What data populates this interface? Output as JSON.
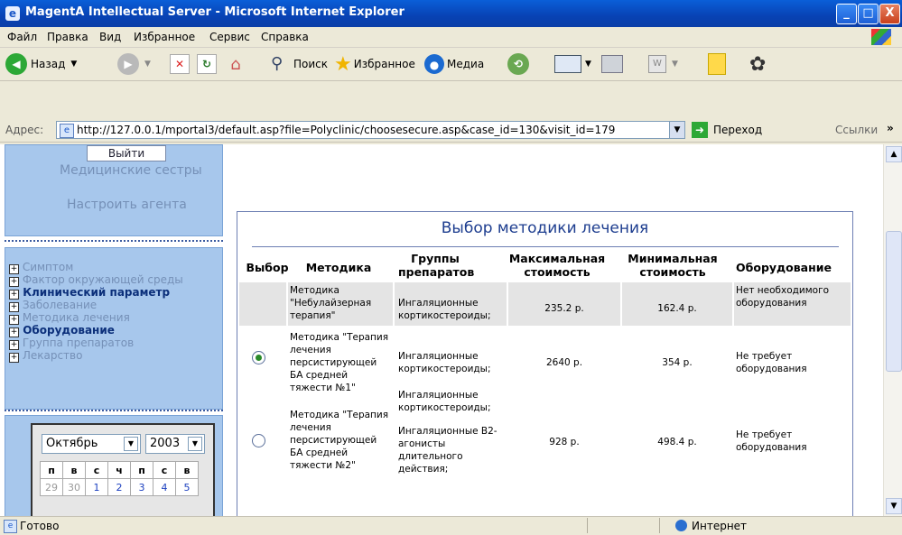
{
  "window": {
    "title": "MagentA Intellectual Server - Microsoft Internet Explorer",
    "min_label": "_",
    "max_label": "□",
    "close_label": "X"
  },
  "menu": {
    "items": [
      "Файл",
      "Правка",
      "Вид",
      "Избранное",
      "Сервис",
      "Справка"
    ]
  },
  "toolbar": {
    "back_label": "Назад",
    "search_label": "Поиск",
    "favorites_label": "Избранное",
    "media_label": "Медиа"
  },
  "address": {
    "label": "Адрес:",
    "url": "http://127.0.0.1/mportal3/default.asp?file=Polyclinic/choosesecure.asp&case_id=130&visit_id=179",
    "go_label": "Переход",
    "links_label": "Ссылки"
  },
  "sidebar": {
    "logout_label": "Выйти",
    "nurses_label": "Медицинские сестры",
    "configure_label": "Настроить агента",
    "tree": [
      {
        "label": "Симптом",
        "bold": false
      },
      {
        "label": "Фактор окружающей среды",
        "bold": false
      },
      {
        "label": "Клинический параметр",
        "bold": true
      },
      {
        "label": "Заболевание",
        "bold": false
      },
      {
        "label": "Методика лечения",
        "bold": false
      },
      {
        "label": "Оборудование",
        "bold": true
      },
      {
        "label": "Группа препаратов",
        "bold": false
      },
      {
        "label": "Лекарство",
        "bold": false
      }
    ],
    "calendar": {
      "month": "Октябрь",
      "year": "2003",
      "weekdays": [
        "п",
        "в",
        "с",
        "ч",
        "п",
        "с",
        "в"
      ],
      "days": [
        "29",
        "30",
        "1",
        "2",
        "3",
        "4",
        "5"
      ]
    }
  },
  "main": {
    "title": "Выбор методики лечения",
    "headers": {
      "select": "Выбор",
      "method": "Методика",
      "groups": "Группы препаратов",
      "max_cost": "Максимальная стоимость",
      "min_cost": "Минимальная стоимость",
      "equipment": "Оборудование"
    },
    "rows": [
      {
        "method": "Методика \"Небулайзерная терапия\"",
        "groups": "Ингаляционные кортикостероиды;",
        "max_cost": "235.2 р.",
        "min_cost": "162.4 р.",
        "equipment": "Нет необходимого оборудования",
        "selected": false
      },
      {
        "method": "Методика \"Терапия лечения персистирующей БА средней тяжести №1\"",
        "groups": "Ингаляционные кортикостероиды;",
        "max_cost": "2640 р.",
        "min_cost": "354 р.",
        "equipment": "Не требует оборудования",
        "selected": true
      },
      {
        "method": "Методика \"Терапия лечения персистирующей БА средней тяжести №2\"",
        "groups": "Ингаляционные кортикостероиды;",
        "groups2": "Ингаляционные В2-агонисты длительного действия;",
        "max_cost": "928 р.",
        "min_cost": "498.4 р.",
        "equipment": "Не требует оборудования",
        "selected": false
      }
    ]
  },
  "status": {
    "ready": "Готово",
    "zone": "Интернет"
  }
}
